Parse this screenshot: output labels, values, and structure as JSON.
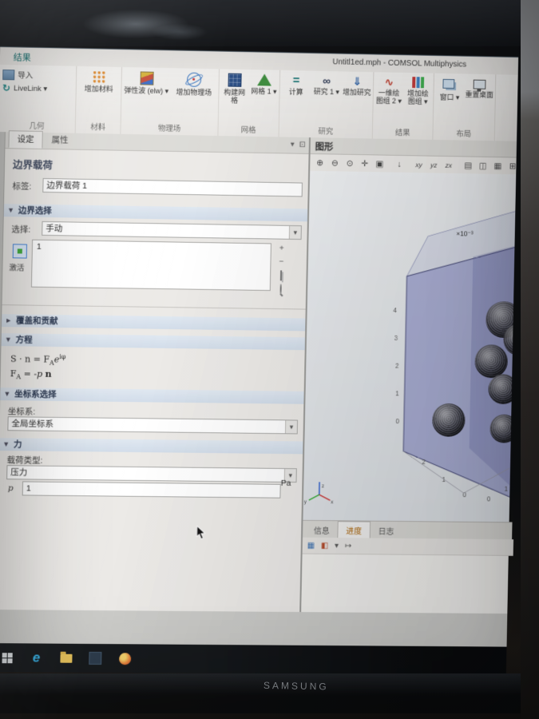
{
  "window": {
    "title": "Untitl1ed.mph - COMSOL Multiphysics"
  },
  "ribbon": {
    "active_tab": "结果",
    "groups": [
      {
        "label": "几何",
        "buttons": [
          {
            "label": "导入"
          },
          {
            "label": "LiveLink ▾"
          }
        ]
      },
      {
        "label": "材料",
        "buttons": [
          {
            "label": "增加材料"
          }
        ]
      },
      {
        "label": "物理场",
        "buttons": [
          {
            "label": "弹性波 (elw) ▾"
          },
          {
            "label": "增加物理场"
          }
        ]
      },
      {
        "label": "网格",
        "buttons": [
          {
            "label": "构建网格"
          },
          {
            "label": "网格 1 ▾"
          }
        ]
      },
      {
        "label": "研究",
        "buttons": [
          {
            "label": "计算"
          },
          {
            "label": "研究 1 ▾"
          },
          {
            "label": "增加研究"
          }
        ]
      },
      {
        "label": "结果",
        "buttons": [
          {
            "label": "一维绘图组 2 ▾"
          },
          {
            "label": "增加绘图组 ▾"
          }
        ]
      },
      {
        "label": "布局",
        "buttons": [
          {
            "label": "窗口 ▾"
          },
          {
            "label": "重置桌面"
          }
        ]
      }
    ]
  },
  "icons": {
    "livelink": "↻",
    "compute": "=",
    "study": "∞",
    "add_study": "⇓",
    "plot_1d": "∿"
  },
  "settings": {
    "tabs": [
      {
        "label": "设定"
      },
      {
        "label": "属性"
      }
    ],
    "panel_controls": [
      {
        "name": "collapse-sections",
        "glyph": "▾"
      },
      {
        "name": "detach-panel",
        "glyph": "⊡"
      }
    ],
    "heading": "边界载荷",
    "label_row": {
      "label": "标签:",
      "value": "边界载荷 1"
    },
    "boundary_selection": {
      "title": "边界选择",
      "selection_label": "选择:",
      "selection_value": "手动",
      "list_items": [
        {
          "value": "1"
        }
      ],
      "active_label": "激活",
      "toolbar": {
        "add": "+",
        "remove": "−"
      }
    },
    "override_section": {
      "title": "覆盖和贡献"
    },
    "equation_section": {
      "title": "方程",
      "eq1": {
        "pre": "S · n = F",
        "sub": "A",
        "base": "e",
        "sup": "iφ"
      },
      "eq2": {
        "pre": "F",
        "sub": "A",
        "post": " = -p ",
        "n": "n"
      }
    },
    "coordinate_section": {
      "title": "坐标系选择",
      "label": "坐标系:",
      "value": "全局坐标系"
    },
    "force_section": {
      "title": "力",
      "load_type_label": "载荷类型:",
      "load_type_value": "压力",
      "p_symbol": "p",
      "p_value": "1",
      "p_unit": "Pa"
    }
  },
  "graphics": {
    "title": "图形",
    "toolbar": [
      {
        "name": "zoom-in",
        "glyph": "⊕"
      },
      {
        "name": "zoom-out",
        "glyph": "⊖"
      },
      {
        "name": "zoom-extents",
        "glyph": "⊙"
      },
      {
        "name": "pan",
        "glyph": "✛"
      },
      {
        "name": "zoom-box",
        "glyph": "▣"
      },
      {
        "name": "go-to-default-view",
        "glyph": "↓"
      },
      {
        "name": "view-xy",
        "glyph": "xy"
      },
      {
        "name": "view-yz",
        "glyph": "yz"
      },
      {
        "name": "view-zx",
        "glyph": "zx"
      },
      {
        "name": "image-snapshot",
        "glyph": "▤"
      },
      {
        "name": "copy-image",
        "glyph": "◫"
      },
      {
        "name": "print",
        "glyph": "▦"
      },
      {
        "name": "scene-settings",
        "glyph": "⊞"
      }
    ],
    "scene": {
      "scale_label": "×10⁻³",
      "z_ticks": [
        "4",
        "3",
        "2",
        "1",
        "0"
      ],
      "bottom_left_ticks": [
        "2",
        "1",
        "0"
      ],
      "bottom_right_ticks": [
        "0",
        "1"
      ],
      "triad": {
        "x": "x",
        "y": "y",
        "z": "z"
      }
    },
    "bottom_tabs": [
      {
        "label": "信息"
      },
      {
        "label": "进度"
      },
      {
        "label": "日志"
      }
    ],
    "minibar": [
      {
        "name": "result-table",
        "glyph": "▦"
      },
      {
        "name": "color-legend",
        "glyph": "◧"
      },
      {
        "name": "expand",
        "glyph": "▾"
      },
      {
        "name": "step-forward",
        "glyph": "↦"
      }
    ]
  },
  "taskbar": {
    "icons": [
      {
        "name": "start"
      },
      {
        "name": "edge"
      },
      {
        "name": "file-explorer"
      },
      {
        "name": "app"
      },
      {
        "name": "browser"
      }
    ]
  },
  "monitor": {
    "brand": "SAMSUNG"
  }
}
